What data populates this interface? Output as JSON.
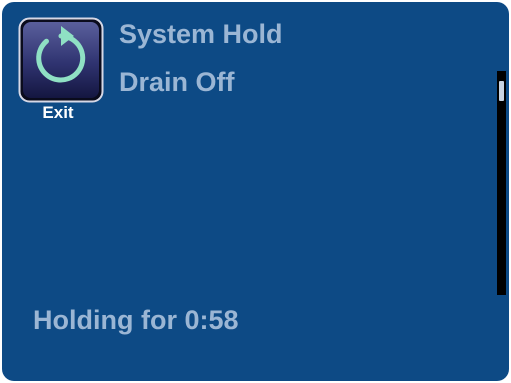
{
  "header": {
    "title": "System Hold",
    "subtitle": "Drain Off"
  },
  "exit_button": {
    "label": "Exit",
    "icon": "undo-arrow-icon"
  },
  "status": {
    "text": "Holding for 0:58"
  },
  "colors": {
    "background": "#0d4a85",
    "text": "#9bb6d4",
    "button_label": "#ffffff"
  }
}
